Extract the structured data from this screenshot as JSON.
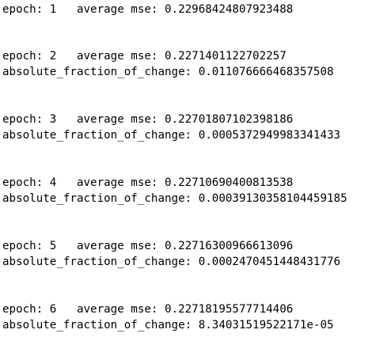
{
  "lines": [
    "epoch: 1   average mse: 0.22968424807923488",
    "epoch: 2   average mse: 0.2271401122702257",
    "absolute_fraction_of_change: 0.011076666468357508",
    "epoch: 3   average mse: 0.22701807102398186",
    "absolute_fraction_of_change: 0.0005372949983341433",
    "epoch: 4   average mse: 0.22710690400813538",
    "absolute_fraction_of_change: 0.00039130358104459185",
    "epoch: 5   average mse: 0.22716300966613096",
    "absolute_fraction_of_change: 0.0002470451448431776",
    "epoch: 6   average mse: 0.22718195577714406",
    "absolute_fraction_of_change: 8.34031519522171e-05"
  ]
}
